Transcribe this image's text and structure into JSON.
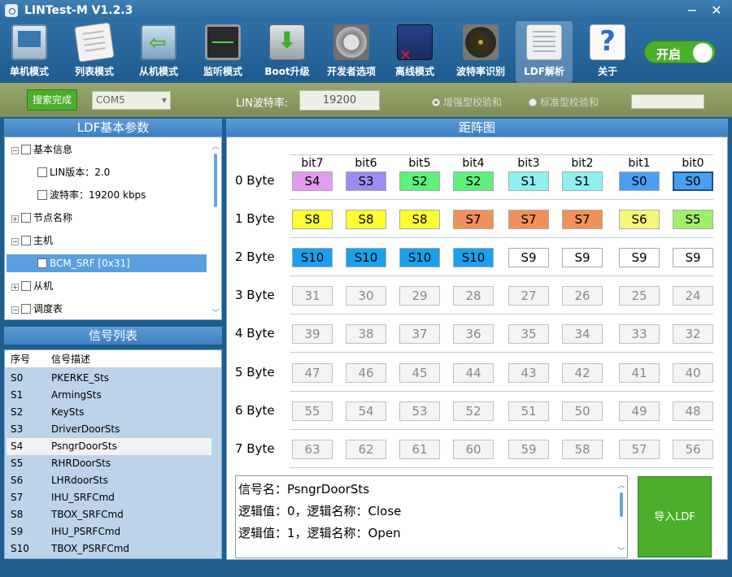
{
  "window": {
    "title": "LINTest-M V1.2.3",
    "minimize_label": "−",
    "close_label": "✕"
  },
  "toolbar": {
    "items": [
      {
        "label": "单机模式",
        "icon": "monitor-icon"
      },
      {
        "label": "列表模式",
        "icon": "list-icon"
      },
      {
        "label": "从机模式",
        "icon": "slave-icon"
      },
      {
        "label": "监听模式",
        "icon": "oscilloscope-icon"
      },
      {
        "label": "Boot升级",
        "icon": "download-icon"
      },
      {
        "label": "开发者选项",
        "icon": "gear-icon"
      },
      {
        "label": "离线模式",
        "icon": "offline-book-icon"
      },
      {
        "label": "波特率识别",
        "icon": "radar-icon"
      },
      {
        "label": "LDF解析",
        "icon": "document-icon"
      },
      {
        "label": "关于",
        "icon": "help-icon"
      }
    ],
    "active": "LDF解析",
    "toggle_label": "开启"
  },
  "settings": {
    "search_button": "搜索完成",
    "com_port": "COM5",
    "baud_label": "LIN波特率:",
    "baud_value": "19200",
    "radio_enhanced": "增强型校验和",
    "radio_standard": "标准型校验和",
    "checksum_value": ""
  },
  "ldf_panel": {
    "title": "LDF基本参数",
    "tree": [
      {
        "label": "基本信息",
        "expander": "−"
      },
      {
        "label": "LIN版本：2.0",
        "expander": ""
      },
      {
        "label": "波特率：19200 kbps",
        "expander": ""
      },
      {
        "label": "节点名称",
        "expander": "+"
      },
      {
        "label": "主机",
        "expander": "−"
      },
      {
        "label": "BCM_SRF [0x31]",
        "expander": ""
      },
      {
        "label": "从机",
        "expander": "+"
      },
      {
        "label": "调度表",
        "expander": "−"
      }
    ]
  },
  "signal_panel": {
    "title": "信号列表",
    "headers": [
      "序号",
      "信号描述"
    ],
    "rows": [
      [
        "S0",
        "PKERKE_Sts"
      ],
      [
        "S1",
        "ArmingSts"
      ],
      [
        "S2",
        "KeySts"
      ],
      [
        "S3",
        "DriverDoorSts"
      ],
      [
        "S4",
        "PsngrDoorSts"
      ],
      [
        "S5",
        "RHRDoorSts"
      ],
      [
        "S6",
        "LHRdoorSts"
      ],
      [
        "S7",
        "IHU_SRFCmd"
      ],
      [
        "S8",
        "TBOX_SRFCmd"
      ],
      [
        "S9",
        "IHU_PSRFCmd"
      ],
      [
        "S10",
        "TBOX_PSRFCmd"
      ]
    ],
    "selected_index": 4
  },
  "matrix": {
    "title": "距阵图",
    "bit_labels": [
      "bit7",
      "bit6",
      "bit5",
      "bit4",
      "bit3",
      "bit2",
      "bit1",
      "bit0"
    ],
    "byte_labels": [
      "0 Byte",
      "1 Byte",
      "2 Byte",
      "3 Byte",
      "4 Byte",
      "5 Byte",
      "6 Byte",
      "7 Byte"
    ],
    "signal_rows": [
      [
        {
          "t": "S4",
          "c": "#e39af0"
        },
        {
          "t": "S3",
          "c": "#9a8cf0"
        },
        {
          "t": "S2",
          "c": "#5ef07a"
        },
        {
          "t": "S2",
          "c": "#5ef07a"
        },
        {
          "t": "S1",
          "c": "#8ff0f0"
        },
        {
          "t": "S1",
          "c": "#8ff0f0"
        },
        {
          "t": "S0",
          "c": "#4a9ff0"
        },
        {
          "t": "S0",
          "c": "#4a9ff0"
        }
      ],
      [
        {
          "t": "S8",
          "c": "#ffff33"
        },
        {
          "t": "S8",
          "c": "#ffff33"
        },
        {
          "t": "S8",
          "c": "#ffff33"
        },
        {
          "t": "S7",
          "c": "#f0905a"
        },
        {
          "t": "S7",
          "c": "#f0905a"
        },
        {
          "t": "S7",
          "c": "#f0905a"
        },
        {
          "t": "S6",
          "c": "#f6f67a"
        },
        {
          "t": "S5",
          "c": "#a0ee6a"
        }
      ],
      [
        {
          "t": "S10",
          "c": "#1aa0ee"
        },
        {
          "t": "S10",
          "c": "#1aa0ee"
        },
        {
          "t": "S10",
          "c": "#1aa0ee"
        },
        {
          "t": "S10",
          "c": "#1aa0ee"
        },
        {
          "t": "S9",
          "c": "#ffffff"
        },
        {
          "t": "S9",
          "c": "#ffffff"
        },
        {
          "t": "S9",
          "c": "#ffffff"
        },
        {
          "t": "S9",
          "c": "#ffffff"
        }
      ]
    ],
    "number_rows": [
      [
        "31",
        "30",
        "29",
        "28",
        "27",
        "26",
        "25",
        "24"
      ],
      [
        "39",
        "38",
        "37",
        "36",
        "35",
        "34",
        "33",
        "32"
      ],
      [
        "47",
        "46",
        "45",
        "44",
        "43",
        "42",
        "41",
        "40"
      ],
      [
        "55",
        "54",
        "53",
        "52",
        "51",
        "50",
        "49",
        "48"
      ],
      [
        "63",
        "62",
        "61",
        "60",
        "59",
        "58",
        "57",
        "56"
      ]
    ]
  },
  "info": {
    "lines": [
      "信号名：PsngrDoorSts",
      "逻辑值：0，逻辑名称：Close",
      "逻辑值：1，逻辑名称：Open"
    ],
    "import_button": "导入LDF"
  }
}
